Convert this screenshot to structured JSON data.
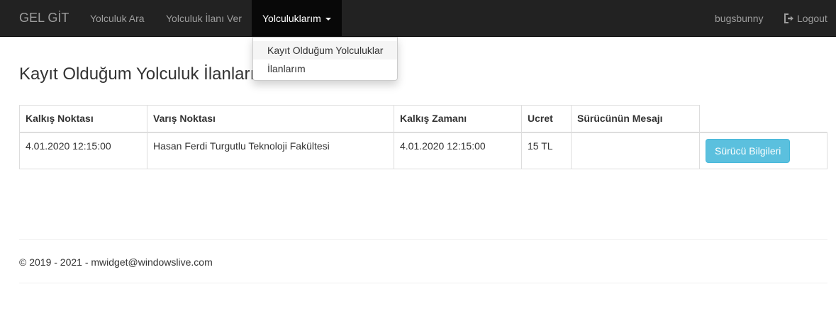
{
  "navbar": {
    "brand": "GEL GİT",
    "links": [
      "Yolculuk Ara",
      "Yolculuk İlanı Ver"
    ],
    "active_menu": "Yolculuklarım",
    "username": "bugsbunny",
    "logout": "Logout",
    "logout_icon": "logout-icon",
    "colors": {
      "background": "#222222",
      "active_background": "#080808",
      "link": "#9d9d9d",
      "active_link": "#ffffff"
    }
  },
  "dropdown": {
    "items": [
      "Kayıt Olduğum Yolculuklar",
      "İlanlarım"
    ]
  },
  "page": {
    "title": "Kayıt Olduğum Yolculuk İlanları"
  },
  "table": {
    "headers": [
      "Kalkış Noktası",
      "Varış Noktası",
      "Kalkış Zamanı",
      "Ucret",
      "Sürücünün Mesajı"
    ],
    "rows": [
      {
        "cells": [
          "4.01.2020 12:15:00",
          "Hasan Ferdi Turgutlu Teknoloji Fakültesi",
          "4.01.2020 12:15:00",
          "15 TL",
          ""
        ],
        "action_label": "Sürücü Bilgileri"
      }
    ],
    "button_color": "#5bc0de"
  },
  "footer": {
    "text": "© 2019 - 2021 - mwidget@windowslive.com"
  }
}
